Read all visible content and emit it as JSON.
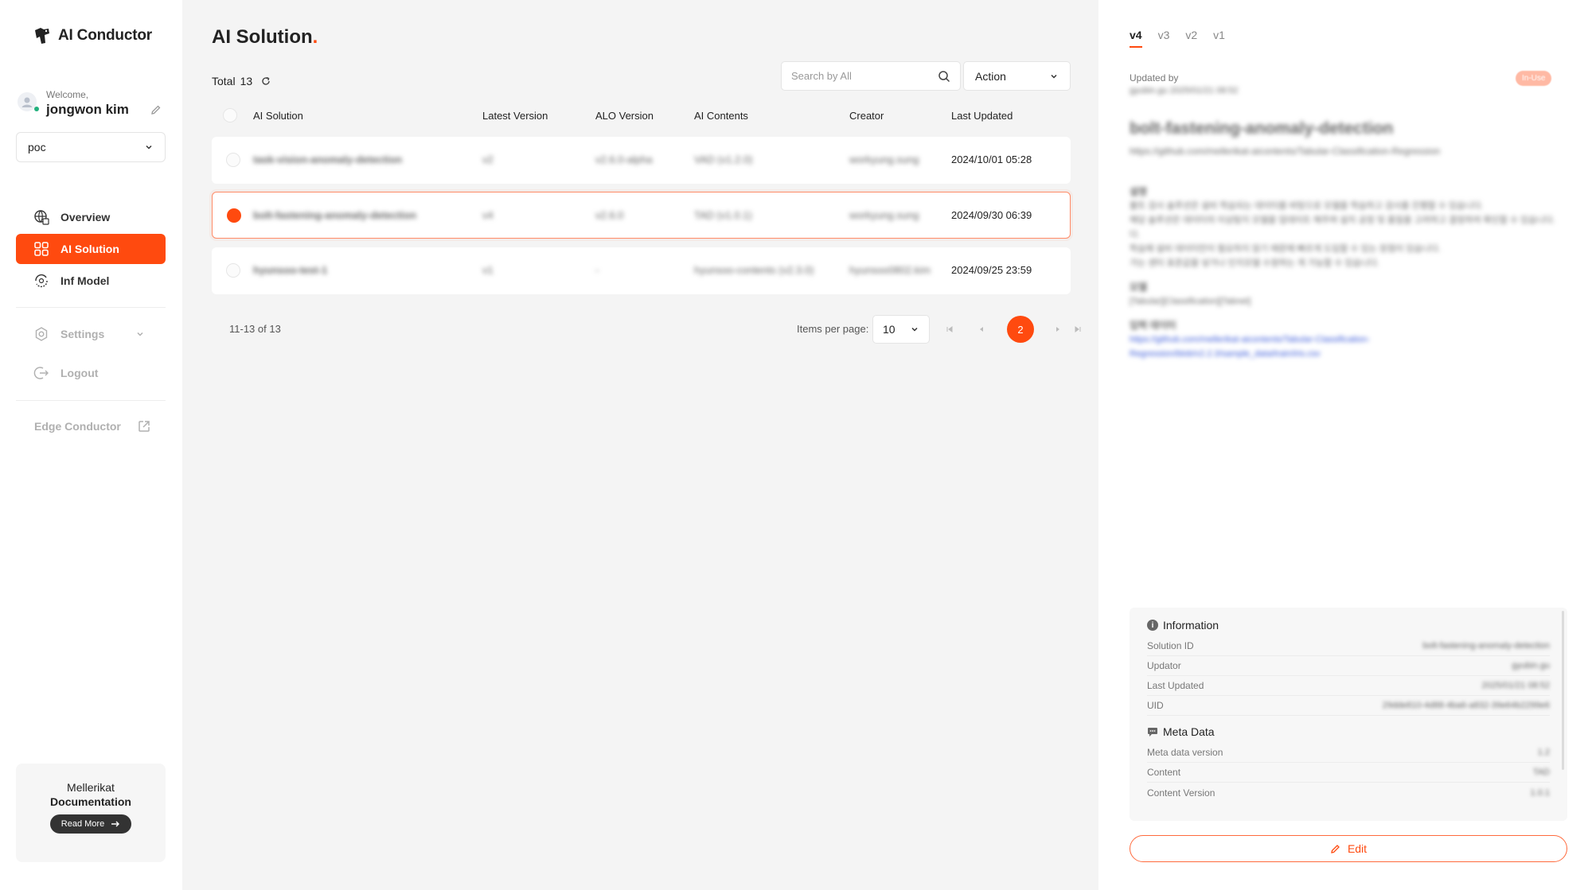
{
  "app": {
    "title": "AI Conductor"
  },
  "user": {
    "welcome": "Welcome,",
    "name": "jongwon kim",
    "project": "poc"
  },
  "nav": {
    "items": [
      {
        "label": "Overview",
        "icon": "globe-grid-icon",
        "active": false
      },
      {
        "label": "AI Solution",
        "icon": "grid-icon",
        "active": true
      },
      {
        "label": "Inf Model",
        "icon": "brain-refresh-icon",
        "active": false
      }
    ],
    "settings": "Settings",
    "logout": "Logout",
    "edge": "Edge Conductor"
  },
  "docs": {
    "brand": "Mellerikat",
    "title": "Documentation",
    "button": "Read More"
  },
  "main": {
    "title": "AI Solution",
    "title_dot": ".",
    "total_label": "Total",
    "total_count": "13",
    "search_placeholder": "Search by All",
    "action_label": "Action",
    "columns": [
      "AI Solution",
      "Latest Version",
      "ALO Version",
      "AI Contents",
      "Creator",
      "Last Updated"
    ],
    "rows": [
      {
        "name": "task-vision-anomaly-detection",
        "latest": "v2",
        "alo": "v2.6.0-alpha",
        "contents": "VAD (v1.2.0)",
        "creator": "workyung.sung",
        "updated": "2024/10/01 05:28",
        "selected": false
      },
      {
        "name": "bolt-fastening-anomaly-detection",
        "latest": "v4",
        "alo": "v2.6.0",
        "contents": "TAD (v1.0.1)",
        "creator": "workyung.sung",
        "updated": "2024/09/30 06:39",
        "selected": true
      },
      {
        "name": "hyunsoo-test-1",
        "latest": "v1",
        "alo": "-",
        "contents": "hyunsoo-contents (v2.3.0)",
        "creator": "hyunsoo0802.kim",
        "updated": "2024/09/25 23:59",
        "selected": false
      }
    ],
    "pagination": {
      "range": "11-13 of 13",
      "items_per_page_label": "Items per page:",
      "items_per_page": "10",
      "current_page": "2"
    }
  },
  "detail": {
    "tabs": [
      "v4",
      "v3",
      "v2",
      "v1"
    ],
    "updated_by_label": "Updated by",
    "updated_by_value": "gyubin.gu 2025/01/21 08:52",
    "status": "In-Use",
    "solution_name": "bolt-fastening-anomaly-detection",
    "solution_url": "https://github.com/mellerikat-aicontents/Tabular-Classification-Regression",
    "desc_heading": "설명",
    "desc_lines": [
      "볼트 검사 솔루션은 설비 학습되는 데이터를 바탕으로 모델을 학습하고 검사를 진행할 수 있습니다.",
      "해당 솔루션은 데이터의 이상탐지 모델을 업데이트 해주며 설치 공정 및 품질을 고려하고 결정하여 확인할 수 있습니다.",
      "다.",
      "학습에 설비 데이터만이 필요하지 않기 때문에 빠르게 도입할 수 있는 장점이 있습니다.",
      "가는 센터 표준값을 넣거나 인지모델 수정하는 게 가능할 수 있습니다."
    ],
    "model_heading": "모델",
    "model_value": "[Tabular][Classification][Tabnet]",
    "input_heading": "입력 데이터",
    "input_link_1": "https://github.com/mellerikat-aicontents/Tabular-Classification-",
    "input_link_2": "Regression/blob/v2.2.3/sample_data/train/iris.csv",
    "info": {
      "heading": "Information",
      "items": [
        {
          "k": "Solution ID",
          "v": "bolt-fastening-anomaly-detection"
        },
        {
          "k": "Updator",
          "v": "gyubin.gu"
        },
        {
          "k": "Last Updated",
          "v": "2025/01/21 08:52"
        },
        {
          "k": "UID",
          "v": "29dde810-4d88-4ba6-a832-39e64b2299e6"
        }
      ]
    },
    "meta": {
      "heading": "Meta Data",
      "items": [
        {
          "k": "Meta data version",
          "v": "1.2"
        },
        {
          "k": "Content",
          "v": "TAD"
        },
        {
          "k": "Content Version",
          "v": "1.0.1"
        }
      ]
    },
    "edit_label": "Edit"
  },
  "colors": {
    "accent": "#ff4a0f",
    "link": "#3556d9"
  }
}
